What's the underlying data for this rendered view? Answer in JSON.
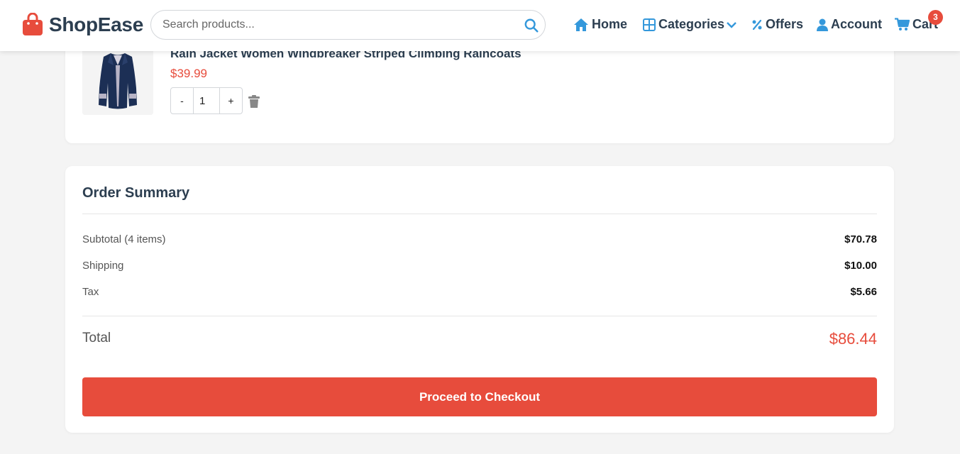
{
  "brand": {
    "name": "ShopEase",
    "accent_color": "#e74c3c",
    "primary_text_color": "#2c3e50",
    "icon_color": "#3498db"
  },
  "search": {
    "placeholder": "Search products...",
    "value": "",
    "icon": "search-icon"
  },
  "nav": {
    "home": {
      "label": "Home",
      "icon": "home-icon"
    },
    "categories": {
      "label": "Categories",
      "icon": "grid-icon",
      "dropdown_icon": "chevron-down-icon"
    },
    "offers": {
      "label": "Offers",
      "icon": "percent-icon"
    },
    "account": {
      "label": "Account",
      "icon": "user-icon"
    },
    "cart": {
      "label": "Cart",
      "icon": "cart-icon",
      "badge_count": "3"
    }
  },
  "cart_item": {
    "title": "Rain Jacket Women Windbreaker Striped Climbing Raincoats",
    "price": "$39.99",
    "quantity": "1",
    "decrement_label": "-",
    "increment_label": "+",
    "image": "navy-rain-jacket",
    "remove_icon": "trash-icon"
  },
  "summary": {
    "title": "Order Summary",
    "rows": [
      {
        "label": "Subtotal (4 items)",
        "value": "$70.78"
      },
      {
        "label": "Shipping",
        "value": "$10.00"
      },
      {
        "label": "Tax",
        "value": "$5.66"
      }
    ],
    "total_label": "Total",
    "total_value": "$86.44",
    "checkout_label": "Proceed to Checkout"
  }
}
